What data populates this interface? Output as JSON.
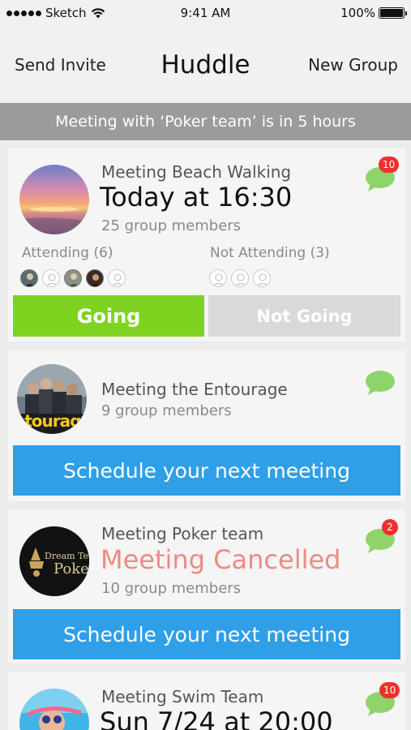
{
  "status_bar": {
    "carrier": "Sketch",
    "time": "9:41 AM",
    "battery": "100%"
  },
  "nav": {
    "left_label": "Send Invite",
    "title": "Huddle",
    "right_label": "New Group"
  },
  "notice": "Meeting with ‘Poker team’ is in 5 hours",
  "cards": [
    {
      "name": "Meeting Beach Walking",
      "time": "Today at 16:30",
      "members": "25 group members",
      "badge": "10",
      "attending_label": "Attending (6)",
      "not_attending_label": "Not Attending (3)",
      "going_label": "Going",
      "not_going_label": "Not Going"
    },
    {
      "name": "Meeting the Entourage",
      "members": "9 group members",
      "avatar_text": "ntourag",
      "button": "Schedule your next meeting"
    },
    {
      "name": "Meeting Poker team",
      "status": "Meeting Cancelled",
      "members": "10 group members",
      "badge": "2",
      "avatar_text_1": "Dream Te",
      "avatar_text_2": "Poke",
      "button": "Schedule your next meeting"
    },
    {
      "name": "Meeting Swim Team",
      "time": "Sun 7/24 at 20:00",
      "badge": "10"
    }
  ],
  "colors": {
    "accent_blue": "#2f9fe8",
    "going_green": "#7ed321",
    "cancel_red": "#ee8a83",
    "badge_red": "#f0302c",
    "chat_green": "#8fd46b"
  }
}
